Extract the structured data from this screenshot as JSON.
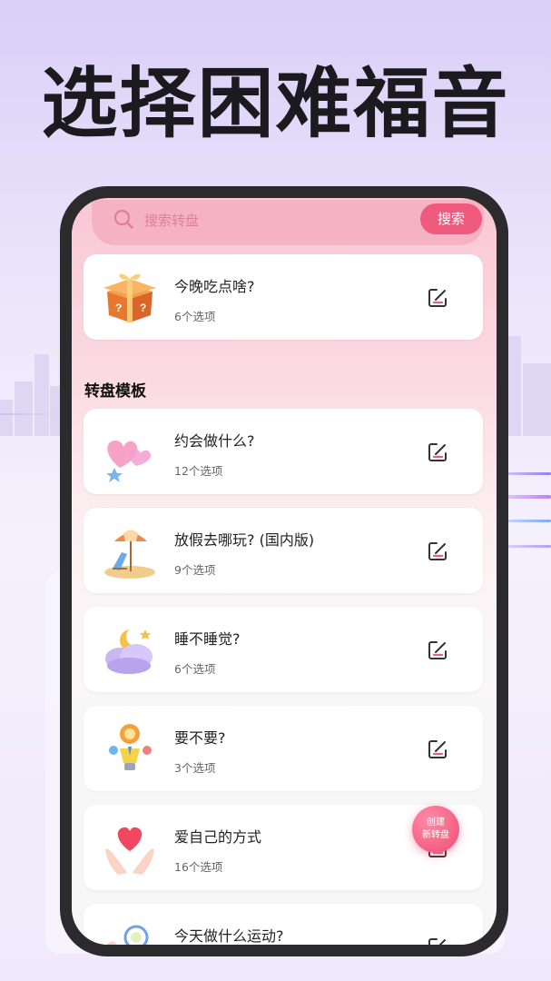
{
  "headline": "选择困难福音",
  "search": {
    "placeholder": "搜索转盘",
    "button_label": "搜索"
  },
  "featured": {
    "title": "今晚吃点啥?",
    "options": "6个选项",
    "icon": "gift-box-icon"
  },
  "section_title": "转盘模板",
  "templates": [
    {
      "title": "约会做什么?",
      "options": "12个选项",
      "icon": "hearts-icon"
    },
    {
      "title": "放假去哪玩? (国内版)",
      "options": "9个选项",
      "icon": "beach-chair-icon"
    },
    {
      "title": "睡不睡觉?",
      "options": "6个选项",
      "icon": "moon-cloud-icon"
    },
    {
      "title": "要不要?",
      "options": "3个选项",
      "icon": "lightbulb-icon"
    },
    {
      "title": "爱自己的方式",
      "options": "16个选项",
      "icon": "heart-hands-icon"
    },
    {
      "title": "今天做什么运动?",
      "options": "",
      "icon": "racket-icon"
    }
  ],
  "fab": {
    "line1": "创建",
    "line2": "新转盘"
  },
  "colors": {
    "accent": "#f05a7e",
    "search_bg": "#f5b2c2",
    "phone_frame": "#2b2b2e"
  }
}
